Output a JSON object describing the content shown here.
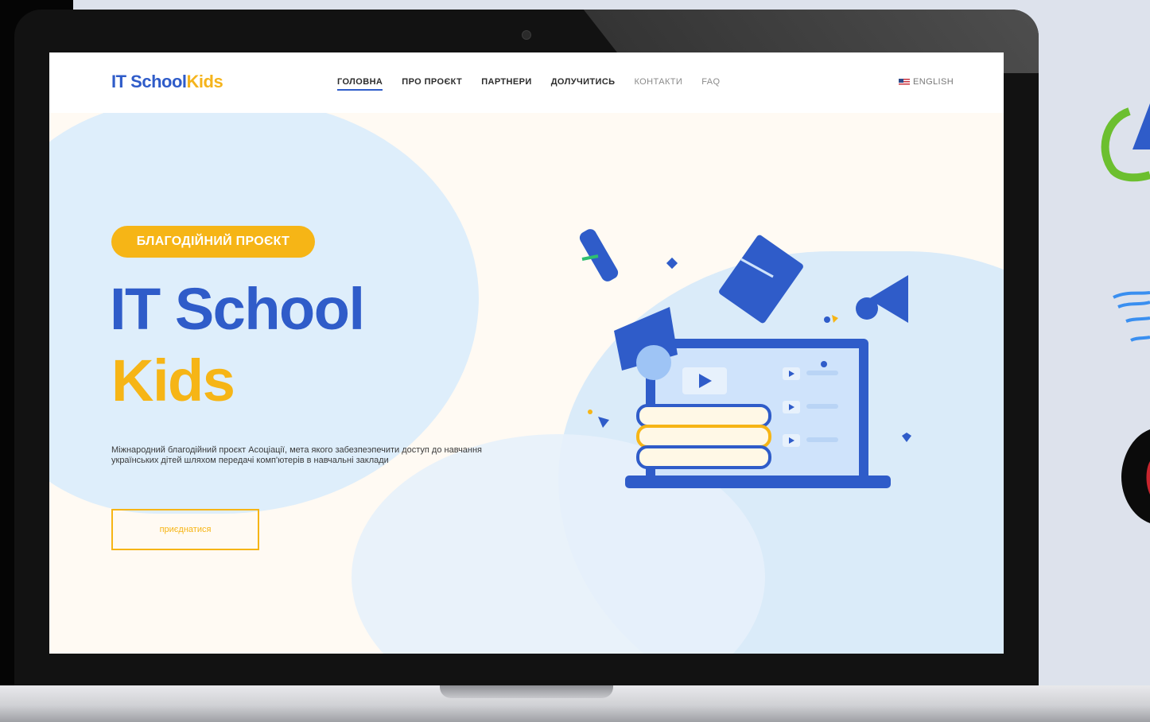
{
  "site": {
    "logo_part1": "IT School",
    "logo_part2": "Kids"
  },
  "nav": {
    "items": [
      {
        "label": "ГОЛОВНА",
        "active": true
      },
      {
        "label": "ПРО ПРОЄКТ"
      },
      {
        "label": "ПАРТНЕРИ"
      },
      {
        "label": "ДОЛУЧИТИСЬ"
      },
      {
        "label": "КОНТАКТИ"
      },
      {
        "label": "FAQ"
      }
    ],
    "language": "ENGLISH"
  },
  "hero": {
    "badge": "БЛАГОДІЙНИЙ ПРОЄКТ",
    "title_line1": "IT School",
    "title_line2": "Kids",
    "description": "Міжнародний благодійний проєкт Асоціації, мета якого забезпеэпечити доступ до навчання українських дітей шляхом передачі комп'ютерів в навчальні заклади",
    "button_label": "приєднатися"
  },
  "colors": {
    "primary_blue": "#2f5cc9",
    "accent_yellow": "#f6b516",
    "page_bg": "#fffaf3"
  }
}
